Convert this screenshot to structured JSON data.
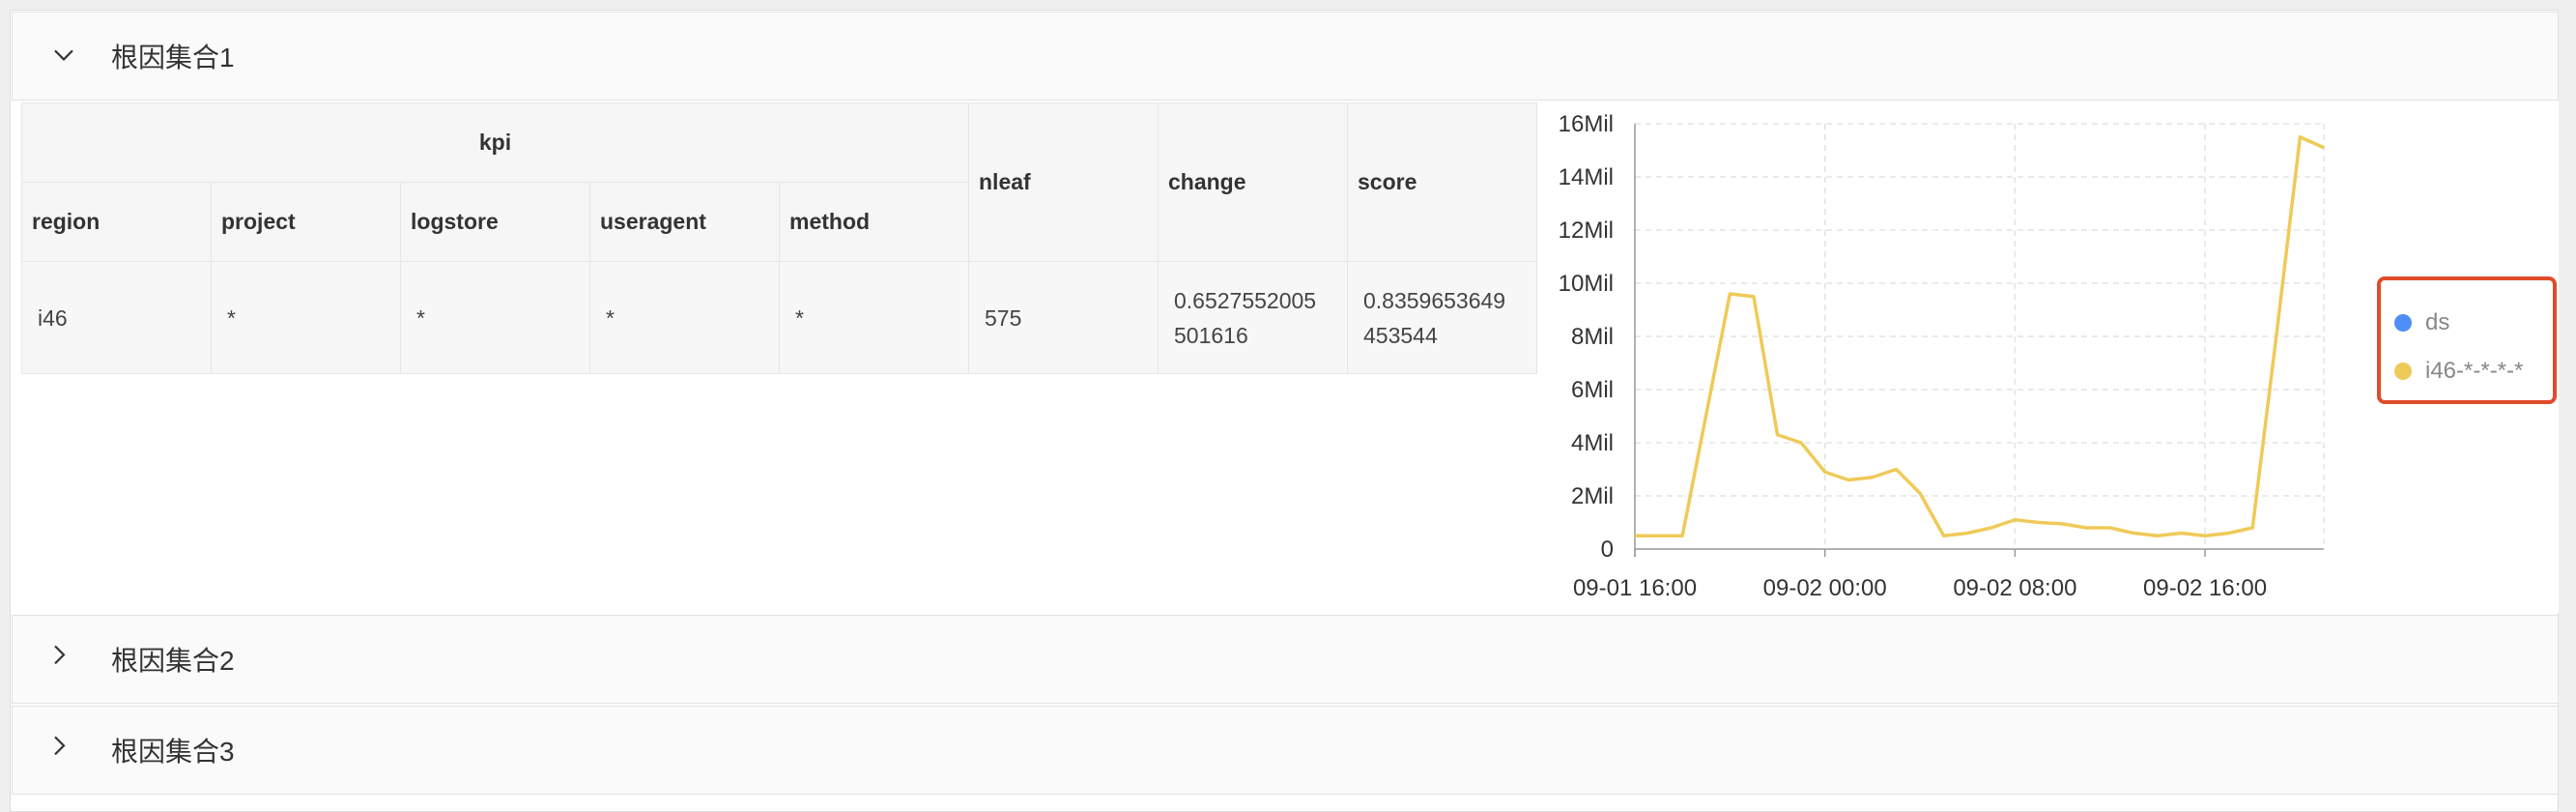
{
  "colors": {
    "ds": "#4f8ef7",
    "i46": "#efca58",
    "highlight": "#e04b2a"
  },
  "panels": [
    {
      "title": "根因集合1",
      "expanded": true,
      "arrow_icon": "chevron-down-icon"
    },
    {
      "title": "根因集合2",
      "expanded": false,
      "arrow_icon": "chevron-right-icon"
    },
    {
      "title": "根因集合3",
      "expanded": false,
      "arrow_icon": "chevron-right-icon"
    }
  ],
  "table": {
    "group_header": "kpi",
    "columns": [
      "region",
      "project",
      "logstore",
      "useragent",
      "method"
    ],
    "extra_columns": [
      "nleaf",
      "change",
      "score"
    ],
    "row": {
      "region": "i46",
      "project": "*",
      "logstore": "*",
      "useragent": "*",
      "method": "*",
      "nleaf": "575",
      "change_line1": "0.6527552005",
      "change_line2": "501616",
      "score_line1": "0.8359653649",
      "score_line2": "453544"
    }
  },
  "legend": {
    "items": [
      {
        "name": "ds",
        "color": "#4f8ef7"
      },
      {
        "name": "i46-*-*-*-*",
        "color": "#efca58"
      }
    ]
  },
  "chart_data": {
    "type": "line",
    "x_tick_labels": [
      "09-01 16:00",
      "09-02 00:00",
      "09-02 08:00",
      "09-02 16:00"
    ],
    "y_tick_labels": [
      "0",
      "2Mil",
      "4Mil",
      "6Mil",
      "8Mil",
      "10Mil",
      "12Mil",
      "14Mil",
      "16Mil"
    ],
    "ylim": [
      0,
      16
    ],
    "y_unit": "Mil",
    "x_range_hours": [
      0,
      29
    ],
    "grid": true,
    "legend_position": "right",
    "series": [
      {
        "name": "ds",
        "x_hours": [],
        "values": []
      },
      {
        "name": "i46-*-*-*-*",
        "x_hours": [
          0,
          2,
          4,
          5,
          6,
          7,
          8,
          9,
          10,
          11,
          12,
          13,
          14,
          15,
          16,
          17,
          18,
          19,
          20,
          21,
          22,
          23,
          24,
          25,
          26,
          27,
          28,
          29
        ],
        "values": [
          0.5,
          0.5,
          9.6,
          9.5,
          4.3,
          4.0,
          2.9,
          2.6,
          2.7,
          3.0,
          2.1,
          0.5,
          0.6,
          0.8,
          1.1,
          1.0,
          0.95,
          0.8,
          0.8,
          0.6,
          0.5,
          0.6,
          0.5,
          0.6,
          0.8,
          8.0,
          15.5,
          15.1
        ]
      }
    ]
  }
}
